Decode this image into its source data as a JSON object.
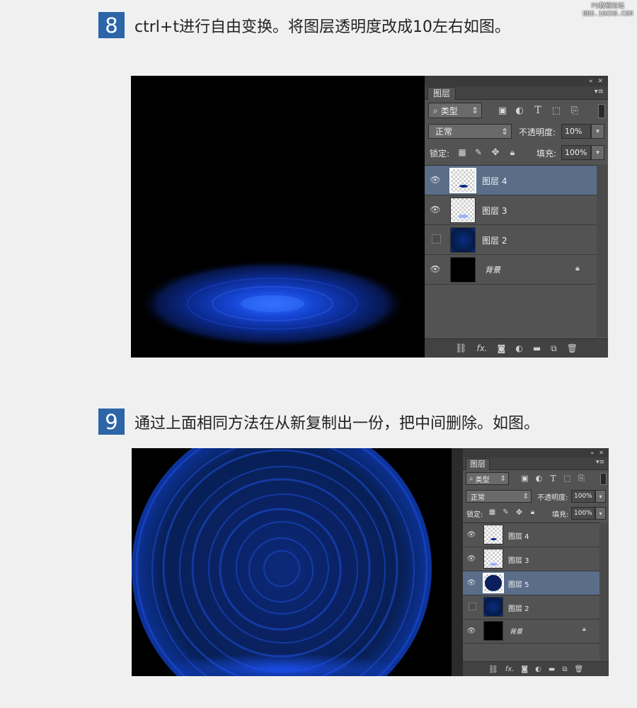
{
  "watermark": {
    "line1": "PS教程论坛",
    "line2": "BBS.16XX8.COM"
  },
  "steps": [
    {
      "number": "8",
      "text": "ctrl+t进行自由变换。将图层透明度改成10左右如图。"
    },
    {
      "number": "9",
      "text": "通过上面相同方法在从新复制出一份，把中间删除。如图。"
    }
  ],
  "panel1": {
    "tab": "图层",
    "filter_kind": "类型",
    "blend_mode": "正常",
    "opacity_label": "不透明度:",
    "opacity_value": "10%",
    "lock_label": "锁定:",
    "fill_label": "填充:",
    "fill_value": "100%",
    "layers": [
      {
        "name": "图层 4",
        "selected": true,
        "visible": true,
        "thumb": "blue-ellipse"
      },
      {
        "name": "图层 3",
        "selected": false,
        "visible": true,
        "thumb": "light-ellipse"
      },
      {
        "name": "图层 2",
        "selected": false,
        "visible": false,
        "thumb": "swirl"
      },
      {
        "name": "背景",
        "selected": false,
        "visible": true,
        "thumb": "black",
        "locked": true
      }
    ]
  },
  "panel2": {
    "tab": "图层",
    "filter_kind": "类型",
    "blend_mode": "正常",
    "opacity_label": "不透明度:",
    "opacity_value": "100%",
    "lock_label": "锁定:",
    "fill_label": "填充:",
    "fill_value": "100%",
    "layers": [
      {
        "name": "图层 4",
        "selected": false,
        "visible": true,
        "thumb": "blue-ellipse"
      },
      {
        "name": "图层 3",
        "selected": false,
        "visible": true,
        "thumb": "light-ellipse"
      },
      {
        "name": "图层 5",
        "selected": true,
        "visible": true,
        "thumb": "dark-circle"
      },
      {
        "name": "图层 2",
        "selected": false,
        "visible": false,
        "thumb": "swirl"
      },
      {
        "name": "背景",
        "selected": false,
        "visible": true,
        "thumb": "black",
        "locked": true
      }
    ]
  },
  "icons": {
    "eye": "eye-icon",
    "lock": "lock-icon",
    "link": "link-icon",
    "fx": "fx-icon",
    "mask": "mask-icon",
    "adjustment": "adjustment-icon",
    "folder": "folder-icon",
    "new_layer": "new-layer-icon",
    "trash": "trash-icon"
  },
  "colors": {
    "step_badge": "#2c65a8",
    "selected_layer": "#5a6e8a",
    "panel_bg": "#535353",
    "glow_blue": "#1f5cff"
  }
}
